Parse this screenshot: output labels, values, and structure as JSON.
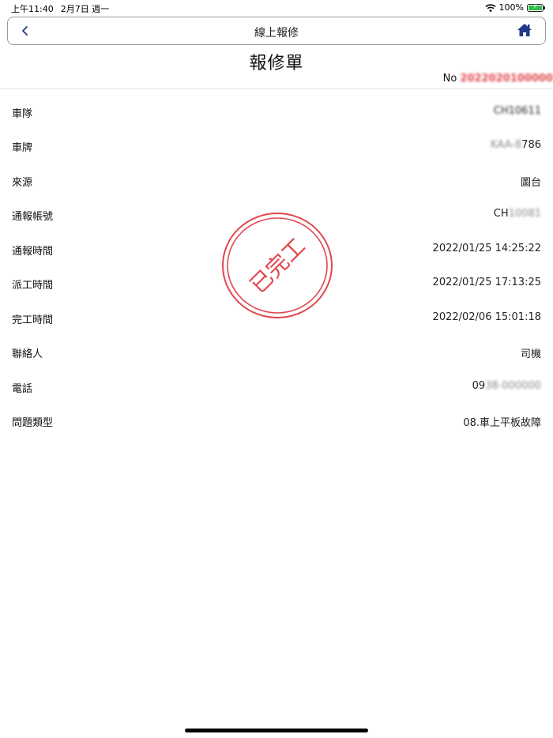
{
  "status_bar": {
    "time": "上午11:40",
    "date": "2月7日 週一",
    "battery": "100%",
    "battery_level": 1.0
  },
  "nav": {
    "title": "線上報修"
  },
  "page": {
    "title": "報修單",
    "order_label": "No ",
    "order_number": "2022020100000"
  },
  "stamp": {
    "text": "已完工",
    "color": "#e0474c"
  },
  "details": [
    {
      "label": "車隊",
      "value": "CH10611"
    },
    {
      "label": "車牌",
      "value": "KAA-8786"
    },
    {
      "label": "來源",
      "value": "圖台"
    },
    {
      "label": "通報帳號",
      "value": "CH10081"
    },
    {
      "label": "通報時間",
      "value": "2022/01/25 14:25:22"
    },
    {
      "label": "派工時間",
      "value": "2022/01/25 17:13:25"
    },
    {
      "label": "完工時間",
      "value": "2022/02/06 15:01:18"
    },
    {
      "label": "聯絡人",
      "value": "司機"
    },
    {
      "label": "電話",
      "value": "0938-000000"
    },
    {
      "label": "問題類型",
      "value": "08.車上平板故障"
    }
  ]
}
